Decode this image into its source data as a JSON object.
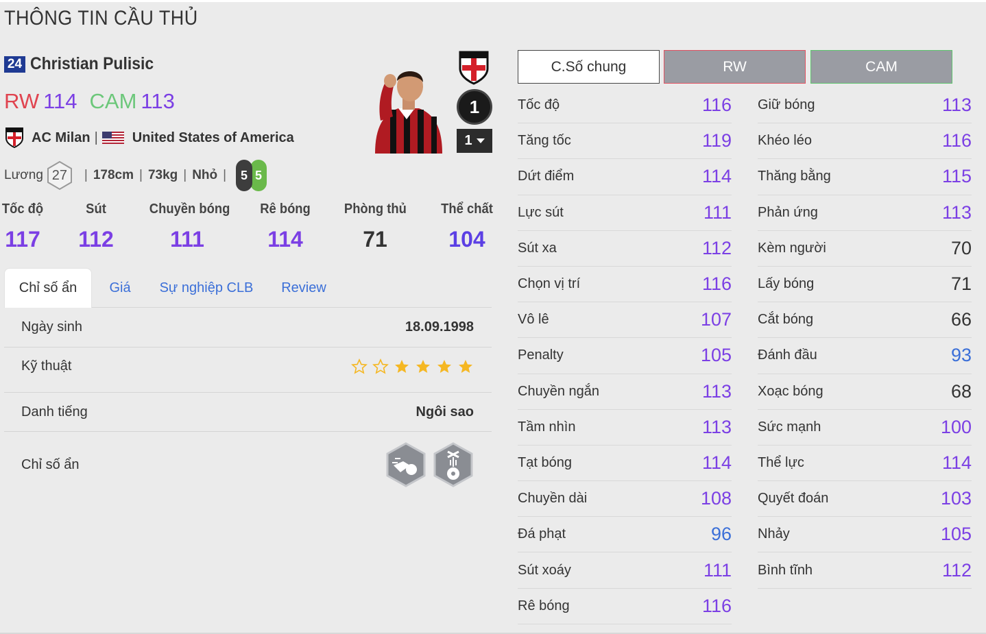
{
  "page_title": "THÔNG TIN CẦU THỦ",
  "player": {
    "season_badge": "24",
    "name": "Christian Pulisic",
    "positions": [
      {
        "label": "RW",
        "value": "114",
        "color": "#e0434f"
      },
      {
        "label": "CAM",
        "value": "113",
        "color": "#6cc77a"
      }
    ],
    "club": "AC Milan",
    "nation": "United States of America",
    "salary_label": "Lương",
    "salary": "27",
    "height": "178cm",
    "weight": "73kg",
    "body": "Nhỏ",
    "left_foot": "5",
    "right_foot": "5",
    "rank": "1",
    "level": "1"
  },
  "main_stats": [
    {
      "label": "Tốc độ",
      "value": "117",
      "color": "#7b3fe4"
    },
    {
      "label": "Sút",
      "value": "112",
      "color": "#7b3fe4"
    },
    {
      "label": "Chuyền bóng",
      "value": "111",
      "color": "#7b3fe4"
    },
    {
      "label": "Rê bóng",
      "value": "114",
      "color": "#7b3fe4"
    },
    {
      "label": "Phòng thủ",
      "value": "71",
      "color": "#333333"
    },
    {
      "label": "Thể chất",
      "value": "104",
      "color": "#5b3fe4"
    }
  ],
  "tabs": [
    "Chỉ số ẩn",
    "Giá",
    "Sự nghiệp CLB",
    "Review"
  ],
  "info": {
    "birth_label": "Ngày sinh",
    "birth_value": "18.09.1998",
    "skill_label": "Kỹ thuật",
    "skill_stars_filled": 4,
    "skill_stars_total": 6,
    "reputation_label": "Danh tiếng",
    "reputation_value": "Ngôi sao",
    "traits_label": "Chỉ số ẩn",
    "trait_icons": [
      "speed-dribbler-icon",
      "puppeteer-icon"
    ]
  },
  "buttons": {
    "general": "C.Số chung",
    "rw": "RW",
    "cam": "CAM"
  },
  "attributes_left": [
    {
      "name": "Tốc độ",
      "value": "116"
    },
    {
      "name": "Tăng tốc",
      "value": "119"
    },
    {
      "name": "Dứt điểm",
      "value": "114"
    },
    {
      "name": "Lực sút",
      "value": "111"
    },
    {
      "name": "Sút xa",
      "value": "112"
    },
    {
      "name": "Chọn vị trí",
      "value": "116"
    },
    {
      "name": "Vô lê",
      "value": "107"
    },
    {
      "name": "Penalty",
      "value": "105"
    },
    {
      "name": "Chuyền ngắn",
      "value": "113"
    },
    {
      "name": "Tầm nhìn",
      "value": "113"
    },
    {
      "name": "Tạt bóng",
      "value": "114"
    },
    {
      "name": "Chuyền dài",
      "value": "108"
    },
    {
      "name": "Đá phạt",
      "value": "96"
    },
    {
      "name": "Sút xoáy",
      "value": "111"
    },
    {
      "name": "Rê bóng",
      "value": "116"
    }
  ],
  "attributes_right": [
    {
      "name": "Giữ bóng",
      "value": "113"
    },
    {
      "name": "Khéo léo",
      "value": "116"
    },
    {
      "name": "Thăng bằng",
      "value": "115"
    },
    {
      "name": "Phản ứng",
      "value": "113"
    },
    {
      "name": "Kèm người",
      "value": "70"
    },
    {
      "name": "Lấy bóng",
      "value": "71"
    },
    {
      "name": "Cắt bóng",
      "value": "66"
    },
    {
      "name": "Đánh đầu",
      "value": "93"
    },
    {
      "name": "Xoạc bóng",
      "value": "68"
    },
    {
      "name": "Sức mạnh",
      "value": "100"
    },
    {
      "name": "Thể lực",
      "value": "114"
    },
    {
      "name": "Quyết đoán",
      "value": "103"
    },
    {
      "name": "Nhảy",
      "value": "105"
    },
    {
      "name": "Bình tĩnh",
      "value": "112"
    }
  ]
}
